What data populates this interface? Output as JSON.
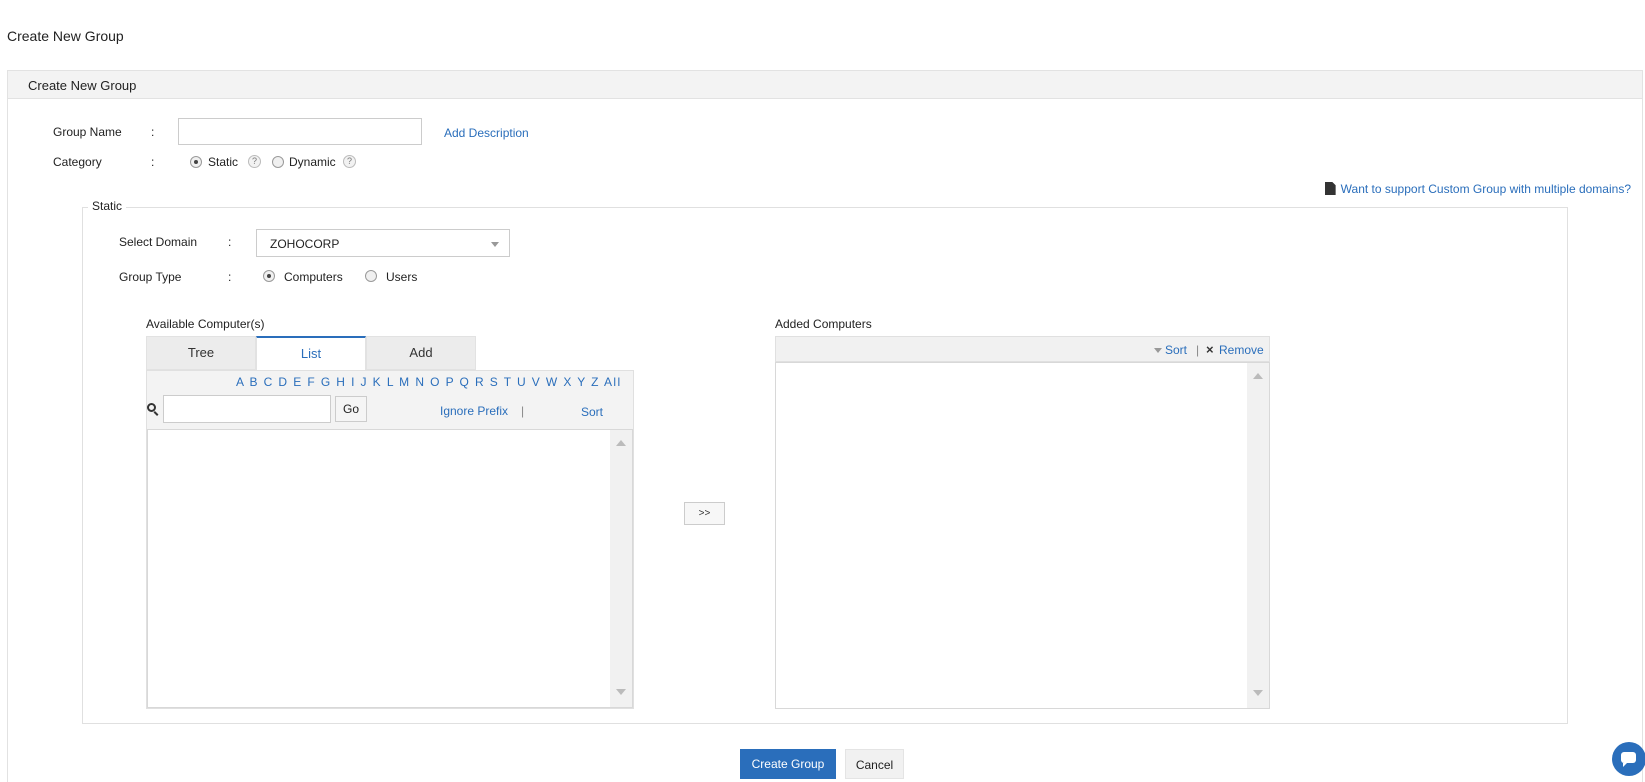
{
  "page": {
    "title": "Create New Group"
  },
  "panel": {
    "header": "Create New Group"
  },
  "form": {
    "group_name_label": "Group Name",
    "colon": ":",
    "group_name_value": "",
    "add_description": "Add Description",
    "category_label": "Category",
    "category_options": [
      "Static",
      "Dynamic"
    ],
    "category_selected": "Static",
    "help_glyph": "?"
  },
  "multi_domain_link": "Want to support Custom Group with multiple domains?",
  "static_section": {
    "legend": "Static",
    "select_domain_label": "Select Domain",
    "domain_value": "ZOHOCORP",
    "group_type_label": "Group Type",
    "group_type_options": [
      "Computers",
      "Users"
    ],
    "group_type_selected": "Computers"
  },
  "available": {
    "label": "Available Computer(s)",
    "tabs": [
      "Tree",
      "List",
      "Add"
    ],
    "active_tab": "List",
    "alphabet": "A B C D E F G H I J K L M N O P Q R S T U V W X Y Z All",
    "search_value": "",
    "go_label": "Go",
    "ignore_prefix": "Ignore Prefix",
    "separator": "|",
    "sort": "Sort"
  },
  "move_button": ">>",
  "added": {
    "label": "Added Computers",
    "sort": "Sort",
    "separator": "|",
    "remove": "Remove"
  },
  "footer": {
    "create": "Create Group",
    "cancel": "Cancel"
  },
  "colors": {
    "accent": "#2a6ebb",
    "panel_header": "#f3f3f3"
  },
  "icons": [
    "search-icon",
    "document-icon",
    "chat-icon",
    "close-icon",
    "caret-down-icon",
    "help-icon"
  ]
}
